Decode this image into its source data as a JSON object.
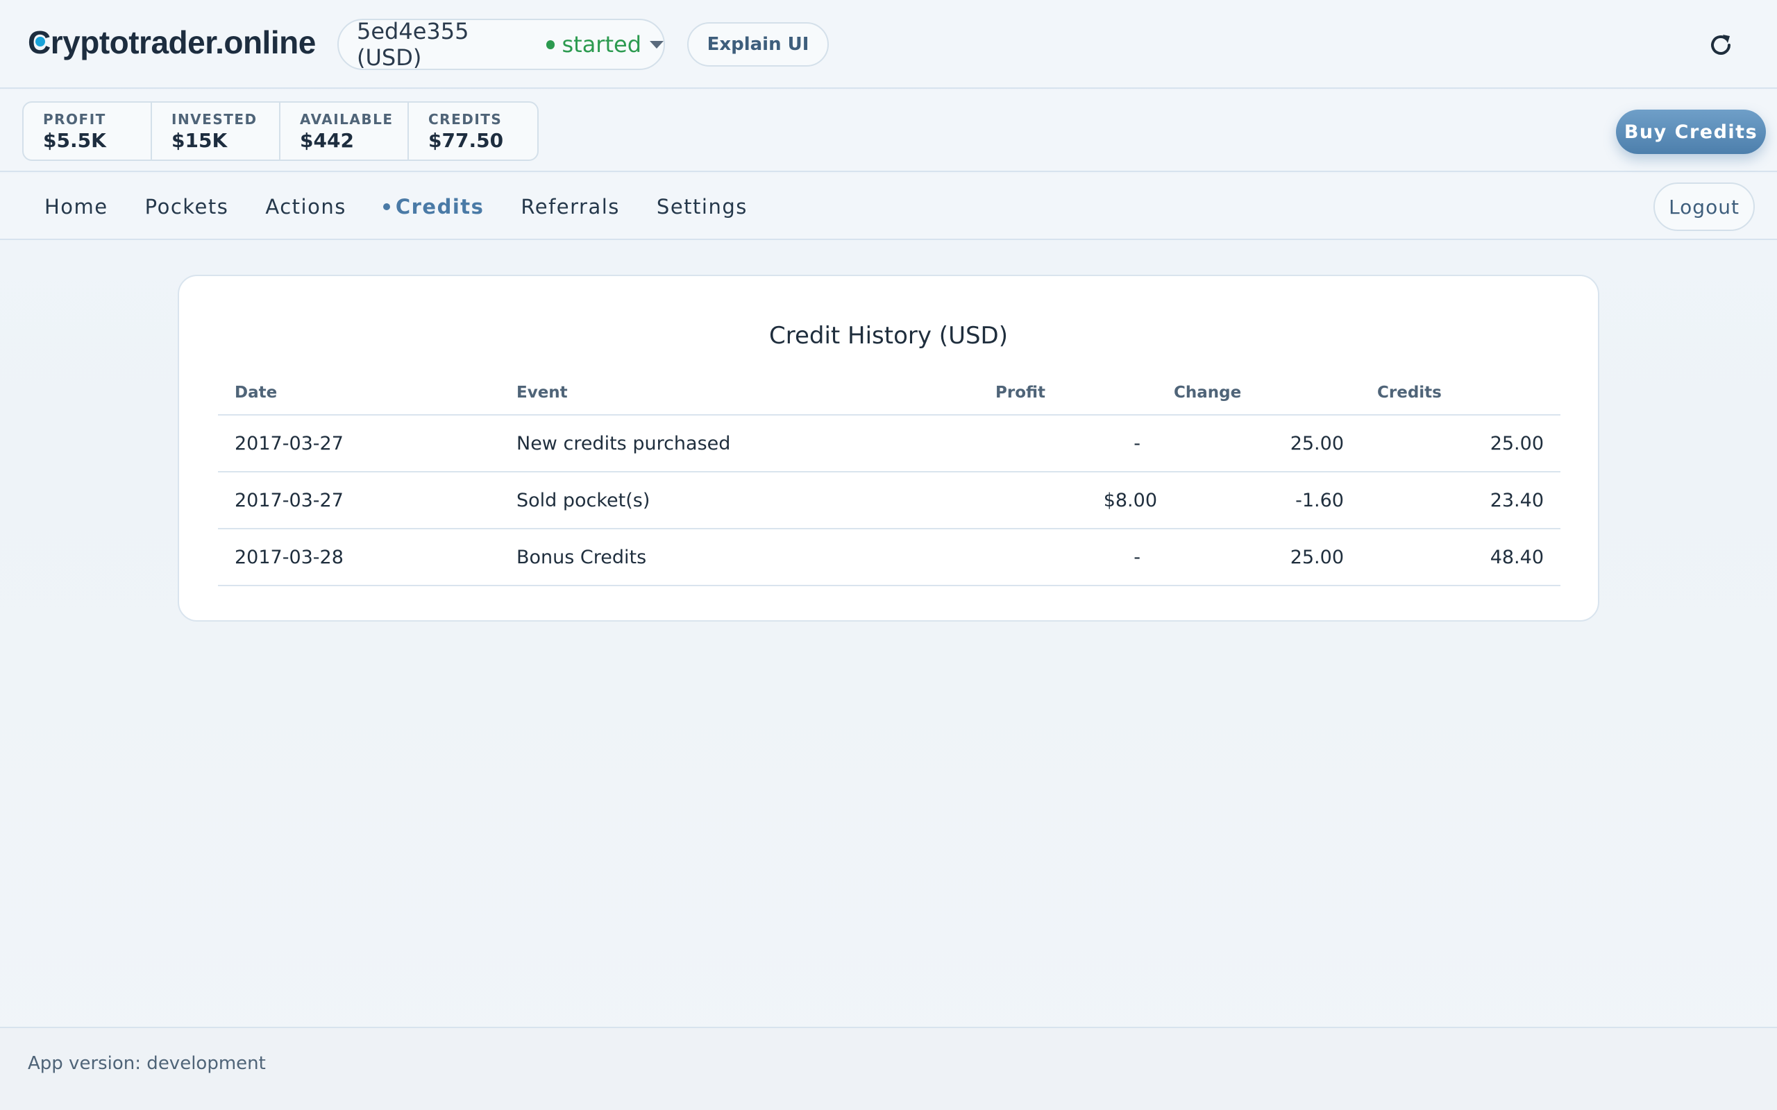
{
  "header": {
    "brand_first": "C",
    "brand_rest": "ryptotrader.online",
    "session_id": "5ed4e355 (USD)",
    "session_status": "started",
    "explain_label": "Explain UI",
    "status_color": "#2b9a4f"
  },
  "stats": [
    {
      "label": "PROFIT",
      "value": "$5.5K"
    },
    {
      "label": "INVESTED",
      "value": "$15K"
    },
    {
      "label": "AVAILABLE",
      "value": "$442"
    },
    {
      "label": "CREDITS",
      "value": "$77.50"
    }
  ],
  "buy_label": "Buy Credits",
  "nav": {
    "items": [
      {
        "label": "Home"
      },
      {
        "label": "Pockets"
      },
      {
        "label": "Actions"
      },
      {
        "label": "Credits",
        "active": true
      },
      {
        "label": "Referrals"
      },
      {
        "label": "Settings"
      }
    ],
    "logout_label": "Logout"
  },
  "credit_history": {
    "title": "Credit History (USD)",
    "columns": [
      "Date",
      "Event",
      "Profit",
      "Change",
      "Credits"
    ],
    "rows": [
      {
        "date": "2017-03-27",
        "event": "New credits purchased",
        "profit": "-",
        "change": "25.00",
        "credits": "25.00"
      },
      {
        "date": "2017-03-27",
        "event": "Sold pocket(s)",
        "profit": "$8.00",
        "change": "-1.60",
        "credits": "23.40"
      },
      {
        "date": "2017-03-28",
        "event": "Bonus Credits",
        "profit": "-",
        "change": "25.00",
        "credits": "48.40"
      }
    ]
  },
  "footer": {
    "version": "App version: development"
  },
  "colors": {
    "accent": "#4a7aa6",
    "started": "#2b9a4f",
    "buy_button": "#5a8bb8"
  }
}
